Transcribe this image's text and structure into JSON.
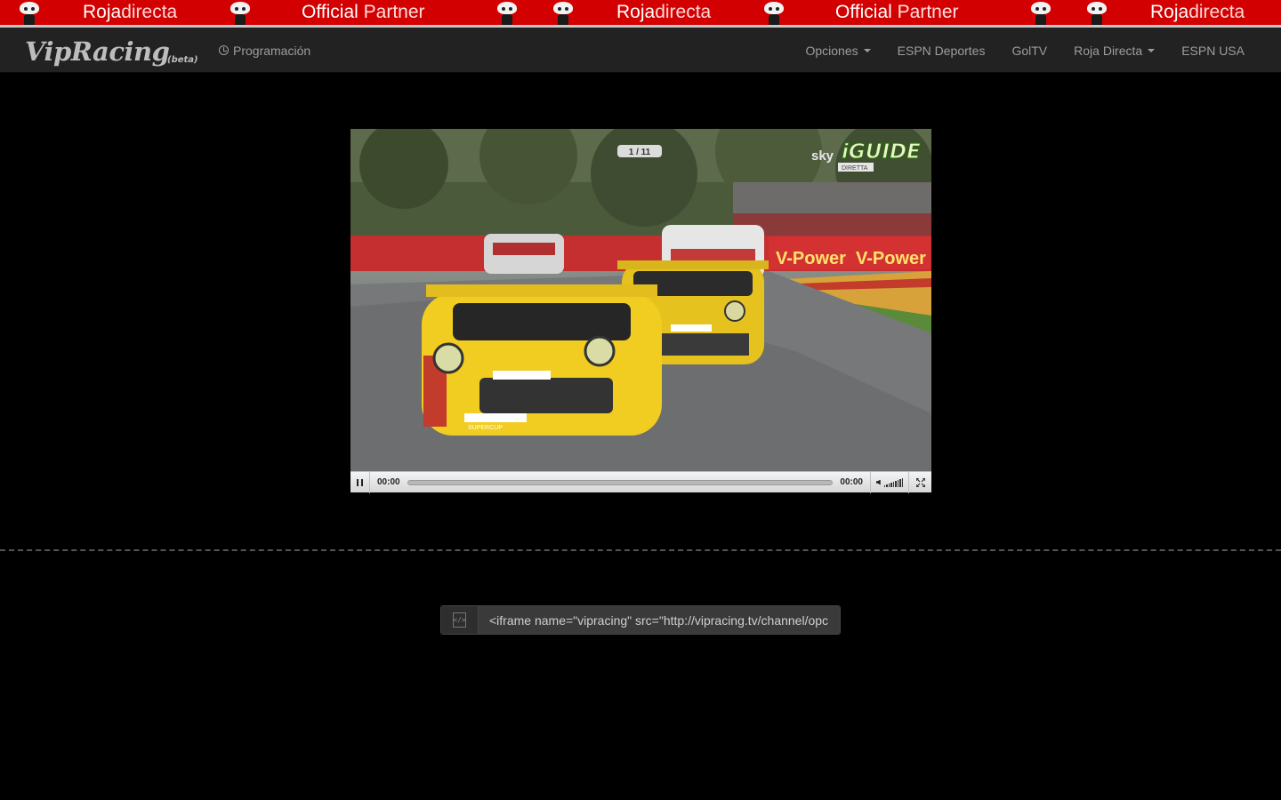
{
  "banner": {
    "items": [
      {
        "strong": "Roja",
        "rest": "directa"
      },
      {
        "strong": "Official",
        "rest": "Partner"
      },
      {
        "strong": "Roja",
        "rest": "directa"
      },
      {
        "strong": "Official",
        "rest": "Partner"
      },
      {
        "strong": "Roja",
        "rest": "directa"
      }
    ],
    "colors": {
      "background": "#d20000"
    }
  },
  "navbar": {
    "brand": "VipRacing",
    "brand_badge": "(beta)",
    "schedule_label": "Programación",
    "items": [
      {
        "label": "Opciones",
        "dropdown": true
      },
      {
        "label": "ESPN Deportes",
        "dropdown": false
      },
      {
        "label": "GolTV",
        "dropdown": false
      },
      {
        "label": "Roja Directa",
        "dropdown": true
      },
      {
        "label": "ESPN USA",
        "dropdown": false
      }
    ]
  },
  "player": {
    "overlay": {
      "channel": "sky",
      "show_logo": "iGUIDE",
      "show_sub": "DIRETTA",
      "position_counter": "1 / 11",
      "sponsor_text": "V-Power"
    },
    "controls": {
      "current_time": "00:00",
      "duration": "00:00",
      "progress": 0
    }
  },
  "embed": {
    "icon": "code-file-icon",
    "value": "<iframe name=\"vipracing\" src=\"http://vipracing.tv/channel/opc"
  }
}
